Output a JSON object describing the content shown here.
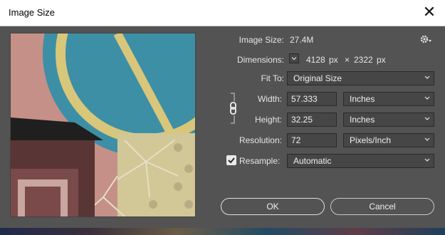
{
  "dialog": {
    "title": "Image Size",
    "close_symbol": "✕"
  },
  "info": {
    "image_size_label": "Image Size:",
    "image_size_value": "27.4M",
    "dimensions_label": "Dimensions:",
    "dim_width": "4128",
    "dim_width_unit": "px",
    "dim_times": "×",
    "dim_height": "2322",
    "dim_height_unit": "px"
  },
  "fit_to": {
    "label": "Fit To:",
    "value": "Original Size"
  },
  "width": {
    "label": "Width:",
    "value": "57.333",
    "unit": "Inches"
  },
  "height": {
    "label": "Height:",
    "value": "32.25",
    "unit": "Inches"
  },
  "resolution": {
    "label": "Resolution:",
    "value": "72",
    "unit": "Pixels/Inch"
  },
  "resample": {
    "label": "Resample:",
    "checked": true,
    "value": "Automatic"
  },
  "buttons": {
    "ok": "OK",
    "cancel": "Cancel"
  },
  "colors": {
    "accent": "#ffffff",
    "panel": "#535353",
    "field": "#464646"
  },
  "icons": {
    "gear": "gear-icon",
    "chain": "link-chain-icon",
    "close": "close-icon"
  }
}
